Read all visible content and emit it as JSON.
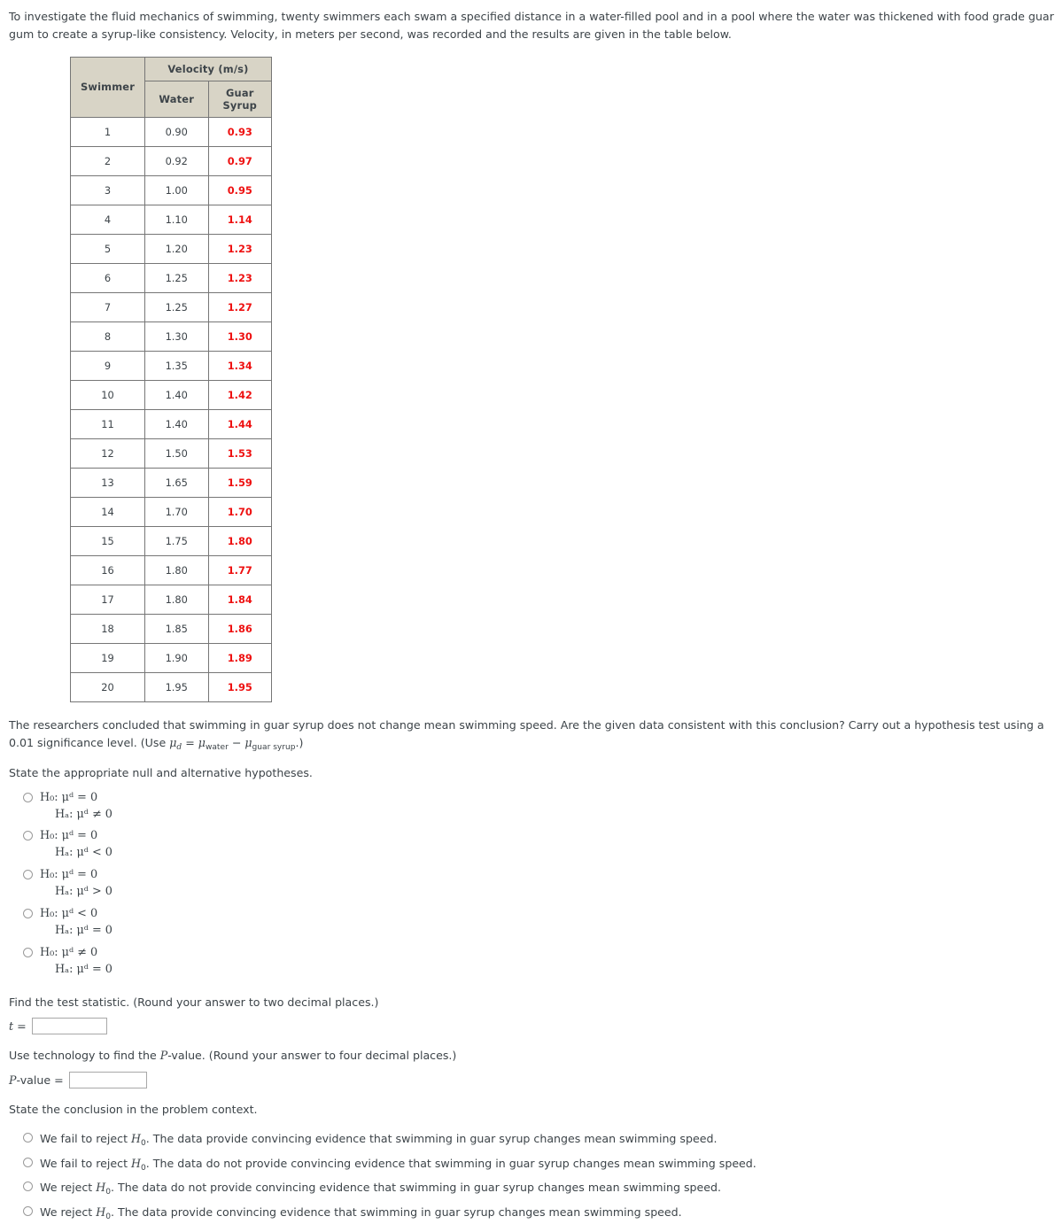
{
  "intro": {
    "paragraph": "To investigate the fluid mechanics of swimming, twenty swimmers each swam a specified distance in a water-filled pool and in a pool where the water was thickened with food grade guar gum to create a syrup-like consistency. Velocity, in meters per second, was recorded and the results are given in the table below."
  },
  "table": {
    "col_swimmer": "Swimmer",
    "col_group": "Velocity (m/s)",
    "col_water": "Water",
    "col_syrup": "Guar Syrup",
    "syrup_color": "#ee1111",
    "header_bg": "#d8d4c6",
    "rows": [
      {
        "swimmer": "1",
        "water": "0.90",
        "syrup": "0.93"
      },
      {
        "swimmer": "2",
        "water": "0.92",
        "syrup": "0.97"
      },
      {
        "swimmer": "3",
        "water": "1.00",
        "syrup": "0.95"
      },
      {
        "swimmer": "4",
        "water": "1.10",
        "syrup": "1.14"
      },
      {
        "swimmer": "5",
        "water": "1.20",
        "syrup": "1.23"
      },
      {
        "swimmer": "6",
        "water": "1.25",
        "syrup": "1.23"
      },
      {
        "swimmer": "7",
        "water": "1.25",
        "syrup": "1.27"
      },
      {
        "swimmer": "8",
        "water": "1.30",
        "syrup": "1.30"
      },
      {
        "swimmer": "9",
        "water": "1.35",
        "syrup": "1.34"
      },
      {
        "swimmer": "10",
        "water": "1.40",
        "syrup": "1.42"
      },
      {
        "swimmer": "11",
        "water": "1.40",
        "syrup": "1.44"
      },
      {
        "swimmer": "12",
        "water": "1.50",
        "syrup": "1.53"
      },
      {
        "swimmer": "13",
        "water": "1.65",
        "syrup": "1.59"
      },
      {
        "swimmer": "14",
        "water": "1.70",
        "syrup": "1.70"
      },
      {
        "swimmer": "15",
        "water": "1.75",
        "syrup": "1.80"
      },
      {
        "swimmer": "16",
        "water": "1.80",
        "syrup": "1.77"
      },
      {
        "swimmer": "17",
        "water": "1.80",
        "syrup": "1.84"
      },
      {
        "swimmer": "18",
        "water": "1.85",
        "syrup": "1.86"
      },
      {
        "swimmer": "19",
        "water": "1.90",
        "syrup": "1.89"
      },
      {
        "swimmer": "20",
        "water": "1.95",
        "syrup": "1.95"
      }
    ]
  },
  "question": {
    "body_part1": "The researchers concluded that swimming in guar syrup does not change mean swimming speed. Are the given data consistent with this conclusion? Carry out a hypothesis test using a 0.01 significance level. (Use ",
    "mu_d": "μ",
    "sub_d": "d",
    "equals": " = ",
    "mu_water": "μ",
    "sub_water": "water",
    "minus": " − ",
    "mu_syrup": "μ",
    "sub_syrup": "guar syrup",
    "body_part2": ".)",
    "significance_level": "0.01",
    "prompt_hypotheses": "State the appropriate null and alternative hypotheses."
  },
  "hypotheses": {
    "options": [
      {
        "null": "H₀: μᵈ = 0",
        "alt": "Hₐ: μᵈ ≠ 0",
        "h0_sym": "H",
        "h0_sub": "0",
        "h0_rel": "=",
        "ha_sub": "a",
        "ha_rel": "≠"
      },
      {
        "null": "H₀: μᵈ = 0",
        "alt": "Hₐ: μᵈ < 0",
        "h0_sym": "H",
        "h0_sub": "0",
        "h0_rel": "=",
        "ha_sub": "a",
        "ha_rel": "<"
      },
      {
        "null": "H₀: μᵈ = 0",
        "alt": "Hₐ: μᵈ > 0",
        "h0_sym": "H",
        "h0_sub": "0",
        "h0_rel": "=",
        "ha_sub": "a",
        "ha_rel": ">"
      },
      {
        "null": "H₀: μᵈ < 0",
        "alt": "Hₐ: μᵈ = 0",
        "h0_sym": "H",
        "h0_sub": "0",
        "h0_rel": "<",
        "ha_sub": "a",
        "ha_rel": "="
      },
      {
        "null": "H₀: μᵈ ≠ 0",
        "alt": "Hₐ: μᵈ = 0",
        "h0_sym": "H",
        "h0_sub": "0",
        "h0_rel": "≠",
        "ha_sub": "a",
        "ha_rel": "="
      }
    ]
  },
  "test_statistic": {
    "prompt": "Find the test statistic. (Round your answer to two decimal places.)",
    "label": "t",
    "equals": " = ",
    "value": "",
    "placeholder": ""
  },
  "p_value": {
    "prompt_pre": "Use technology to find the ",
    "prompt_p": "P",
    "prompt_post": "-value. (Round your answer to four decimal places.)",
    "label_p": "P",
    "label_rest": "-value = ",
    "value": "",
    "placeholder": ""
  },
  "conclusion": {
    "prompt": "State the conclusion in the problem context.",
    "options": [
      {
        "pre": "We fail to reject ",
        "h": "H",
        "sub": "0",
        "post": ". The data provide convincing evidence that swimming in guar syrup changes mean swimming speed."
      },
      {
        "pre": "We fail to reject ",
        "h": "H",
        "sub": "0",
        "post": ". The data do not provide convincing evidence that swimming in guar syrup changes mean swimming speed."
      },
      {
        "pre": "We reject ",
        "h": "H",
        "sub": "0",
        "post": ". The data do not provide convincing evidence that swimming in guar syrup changes mean swimming speed."
      },
      {
        "pre": "We reject ",
        "h": "H",
        "sub": "0",
        "post": ". The data provide convincing evidence that swimming in guar syrup changes mean swimming speed."
      }
    ]
  }
}
